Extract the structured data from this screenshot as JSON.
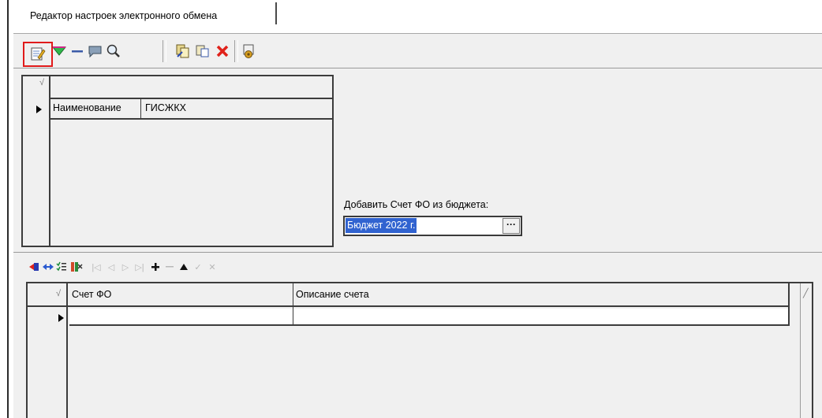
{
  "tab": {
    "title": "Редактор настроек электронного обмена"
  },
  "toolbar": {
    "buttons": [
      {
        "name": "edit",
        "icon": "edit-notepad-icon"
      },
      {
        "name": "filter",
        "icon": "green-funnel-icon"
      },
      {
        "name": "minus",
        "icon": "minus-icon"
      },
      {
        "name": "comment",
        "icon": "speech-bubble-icon"
      },
      {
        "name": "search",
        "icon": "magnifier-icon"
      },
      {
        "name": "copy-records",
        "icon": "copy-records-icon"
      },
      {
        "name": "paste",
        "icon": "paste-icon"
      },
      {
        "name": "delete",
        "icon": "red-x-icon"
      },
      {
        "name": "exchange-settings",
        "icon": "gear-document-icon"
      }
    ]
  },
  "upper_grid": {
    "check_mark": "√",
    "row": {
      "field": "Наименование",
      "value": "ГИСЖКХ"
    }
  },
  "budget": {
    "label": "Добавить Счет ФО из бюджета:",
    "selected": "Бюджет 2022 г.",
    "dropdown_glyph": "···"
  },
  "nav_toolbar": {
    "icons": [
      "red-arrow-in-icon",
      "blue-double-arrow-icon",
      "checklist-icon",
      "settings-columns-icon",
      "first-icon",
      "prior-icon",
      "next-icon",
      "last-icon",
      "plus-icon",
      "minus-icon",
      "up-triangle-icon",
      "check-icon",
      "cancel-icon"
    ]
  },
  "lower_grid": {
    "check_mark": "√",
    "columns": [
      "Счет ФО",
      "Описание счета"
    ],
    "rows": [
      {
        "account": "",
        "description": ""
      }
    ]
  },
  "colors": {
    "panel": "#f0f0f0",
    "selection": "#3163d0",
    "highlight_border": "#e01a1a",
    "grid_line": "#3c3c3c"
  }
}
